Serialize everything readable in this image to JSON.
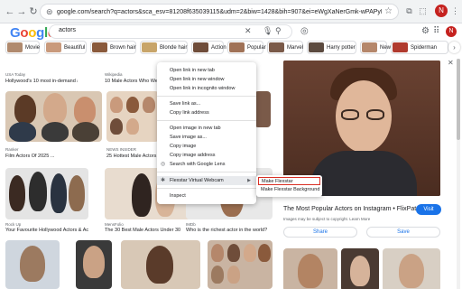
{
  "browser": {
    "url": "google.com/search?q=actors&sca_esv=81208f635039115&udm=2&biw=1428&bih=907&ei=eWgXaNerGmk-wPAPyKK3kQUved=0ahUKEwiNnvbvEnnKAxLH...",
    "back_glyph": "←",
    "forward_glyph": "→",
    "reload_glyph": "↻",
    "star_glyph": "☆",
    "profile_letter": "N"
  },
  "google": {
    "logo": [
      "G",
      "o",
      "o",
      "g",
      "l",
      "e"
    ],
    "query": "actors",
    "avatar_letter": "N"
  },
  "chips": [
    {
      "label": "Movie"
    },
    {
      "label": "Beautiful"
    },
    {
      "label": "Brown hair"
    },
    {
      "label": "Blonde hair"
    },
    {
      "label": "Action"
    },
    {
      "label": "Popular"
    },
    {
      "label": "Marvel"
    },
    {
      "label": "Harry potter"
    },
    {
      "label": "New"
    },
    {
      "label": "Spiderman"
    }
  ],
  "results": [
    {
      "src": "USA Today",
      "caption": "Hollywood's 10 most in-demand actors"
    },
    {
      "src": "Wikipedia",
      "caption": "10 Male Actors Who Were ..."
    },
    {
      "src": "Ranker",
      "caption": "Film Actors Of 2025 ..."
    },
    {
      "src": "NEWS INSIDER",
      "caption": "25 Hottest Male Actors ..."
    },
    {
      "src": "Rock Up",
      "caption": "Your Favourite Hollywood Actors & Actresses ..."
    },
    {
      "src": "MensFolio",
      "caption": "The 30 Best Male Actors Under 30"
    },
    {
      "src": "IMDb",
      "caption": "Who is the richest actor in the world?"
    }
  ],
  "context_menu": {
    "items": [
      {
        "label": "Open link in new tab"
      },
      {
        "label": "Open link in new window"
      },
      {
        "label": "Open link in incognito window"
      },
      {
        "label": "Save link as..."
      },
      {
        "label": "Copy link address"
      },
      {
        "label": "Open image in new tab"
      },
      {
        "label": "Save image as..."
      },
      {
        "label": "Copy image"
      },
      {
        "label": "Copy image address"
      },
      {
        "label": "Search with Google Lens"
      },
      {
        "label": "Flexstar Virtual Webcam"
      },
      {
        "label": "Inspect"
      }
    ],
    "submenu": [
      {
        "label": "Make Flexstar"
      },
      {
        "label": "Make Flexstar Background"
      }
    ]
  },
  "panel": {
    "title": "The Most Popular Actors on Instagram • FlixPatrol",
    "note": "Images may be subject to copyright. Learn More",
    "visit_label": "Visit",
    "share_label": "Share",
    "save_label": "Save"
  },
  "colors": {
    "accent": "#1a73e8",
    "highlight_border": "#d93025",
    "profile": "#c5221f"
  }
}
